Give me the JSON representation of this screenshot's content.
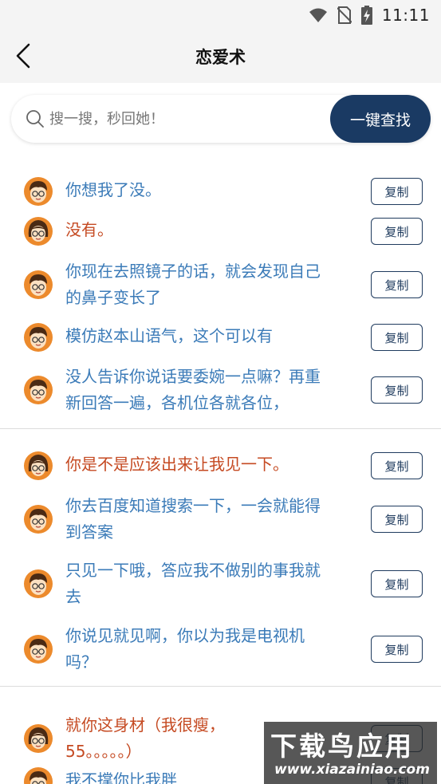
{
  "status_bar": {
    "time": "11:11"
  },
  "header": {
    "title": "恋爱术"
  },
  "search": {
    "placeholder": "搜一搜，秒回她！",
    "button_label": "一键查找"
  },
  "colors": {
    "brand": "#1a3a63",
    "boy_text": "#3b7bb8",
    "girl_text": "#c54a22"
  },
  "copy_label": "复制",
  "groups": [
    {
      "items": [
        {
          "speaker": "boy",
          "lines": [
            "你想我了没。"
          ]
        },
        {
          "speaker": "girl",
          "lines": [
            "没有。"
          ]
        },
        {
          "speaker": "boy",
          "lines": [
            "你现在去照镜子的话，就会发现自己",
            "的鼻子变长了"
          ]
        },
        {
          "speaker": "boy",
          "lines": [
            "模仿赵本山语气，这个可以有"
          ]
        },
        {
          "speaker": "boy",
          "lines": [
            "没人告诉你说话要委婉一点嘛？再重",
            "新回答一遍，各机位各就各位，"
          ]
        }
      ]
    },
    {
      "items": [
        {
          "speaker": "girl",
          "lines": [
            "你是不是应该出来让我见一下。"
          ]
        },
        {
          "speaker": "boy",
          "lines": [
            "你去百度知道搜索一下，一会就能得",
            "到答案"
          ]
        },
        {
          "speaker": "boy",
          "lines": [
            "只见一下哦，答应我不做别的事我就",
            "去"
          ]
        },
        {
          "speaker": "boy",
          "lines": [
            "你说见就见啊，你以为我是电视机",
            "吗？"
          ]
        }
      ]
    },
    {
      "items": [
        {
          "speaker": "girl",
          "lines": [
            "就你这身材（我很瘦，",
            "55。。。。。）"
          ]
        },
        {
          "speaker": "boy",
          "lines": [
            "我不撑你比我胖"
          ]
        }
      ]
    }
  ],
  "watermark": {
    "top": "下载鸟应用",
    "bottom": "www.xiazainiao.com"
  }
}
